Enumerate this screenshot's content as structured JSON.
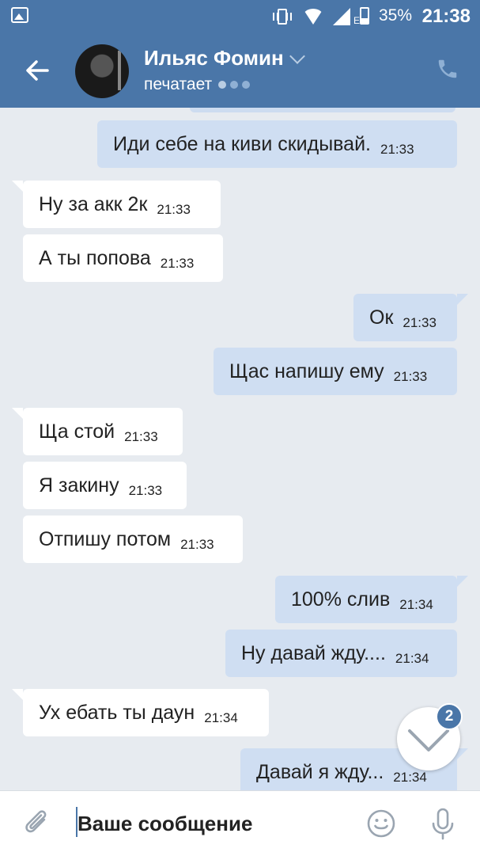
{
  "status_bar": {
    "battery_percent": "35%",
    "time": "21:38",
    "network": "E",
    "icons": [
      "image-icon",
      "vibrate-icon",
      "wifi-icon",
      "signal-icon",
      "battery-icon"
    ]
  },
  "header": {
    "contact_name": "Ильяс Фомин",
    "status": "печатает"
  },
  "messages": [
    {
      "dir": "out",
      "text": "Иди себе на киви скидывай.",
      "time": "21:33"
    },
    {
      "dir": "in",
      "text": "Ну за акк 2к",
      "time": "21:33"
    },
    {
      "dir": "in",
      "text": "А ты попова",
      "time": "21:33"
    },
    {
      "dir": "out",
      "text": "Ок",
      "time": "21:33"
    },
    {
      "dir": "out",
      "text": "Щас напишу ему",
      "time": "21:33"
    },
    {
      "dir": "in",
      "text": "Ща стой",
      "time": "21:33"
    },
    {
      "dir": "in",
      "text": "Я закину",
      "time": "21:33"
    },
    {
      "dir": "in",
      "text": "Отпишу потом",
      "time": "21:33"
    },
    {
      "dir": "out",
      "text": "100% слив",
      "time": "21:34"
    },
    {
      "dir": "out",
      "text": "Ну давай жду....",
      "time": "21:34"
    },
    {
      "dir": "in",
      "text": "Ух ебать ты даун",
      "time": "21:34"
    },
    {
      "dir": "out",
      "text": "Давай я жду...",
      "time": "21:34"
    }
  ],
  "scroll_button": {
    "unread_count": "2"
  },
  "composer": {
    "placeholder": "Ваше сообщение"
  },
  "colors": {
    "header": "#4a76a8",
    "background": "#e7ebf0",
    "incoming": "#ffffff",
    "outgoing": "#cfdef2"
  }
}
